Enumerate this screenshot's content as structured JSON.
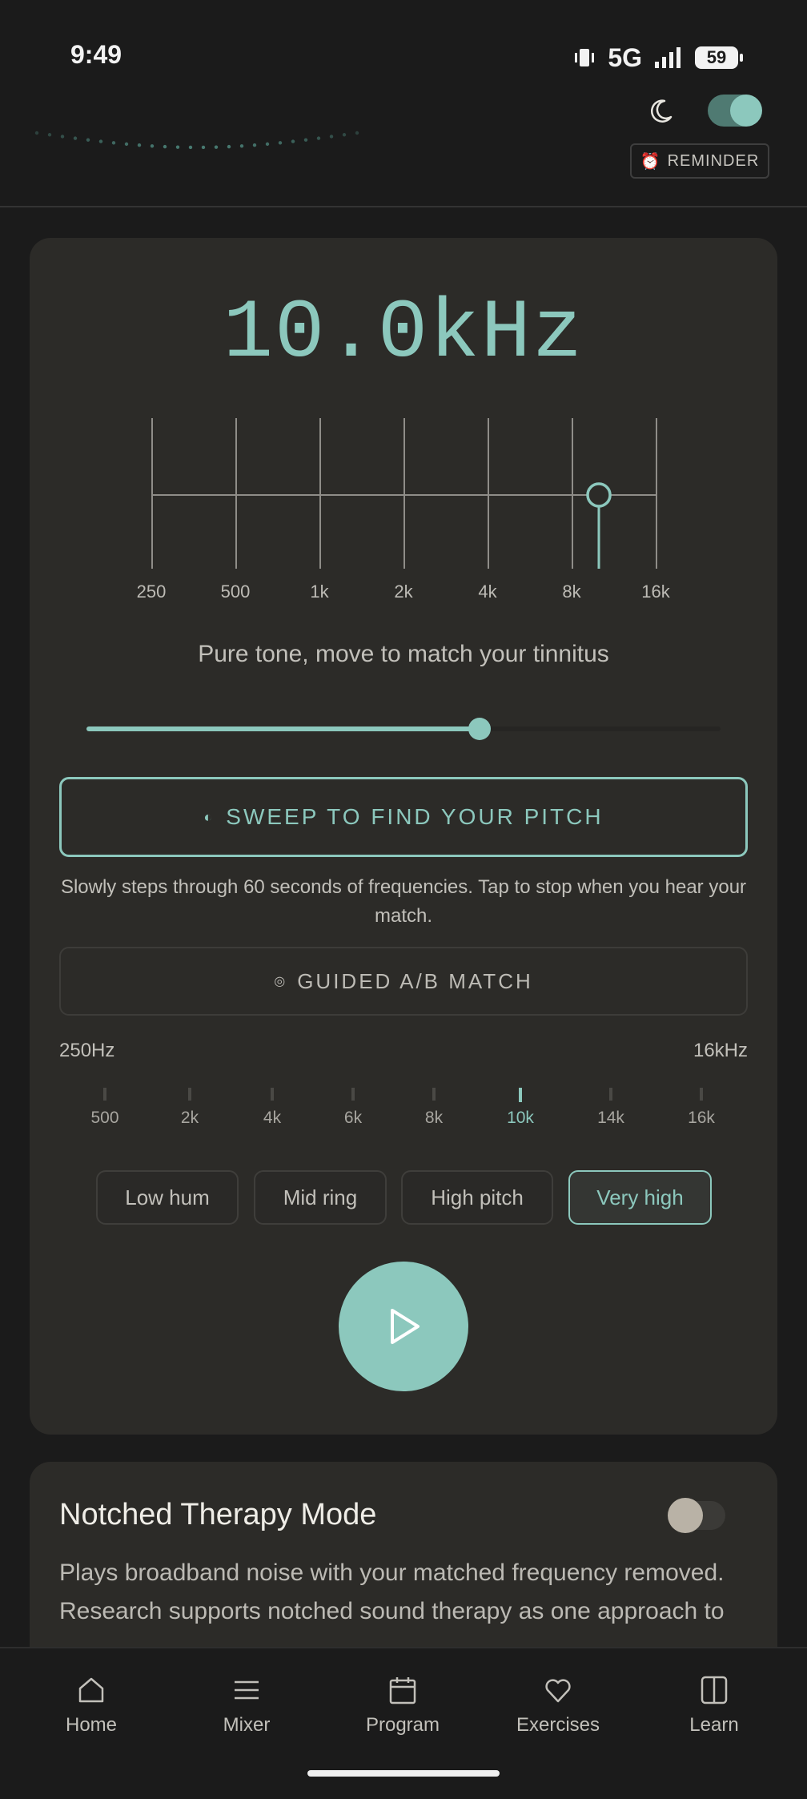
{
  "status_bar": {
    "time": "9:49",
    "network": "5G",
    "battery": "59"
  },
  "header": {
    "reminder_icon": "⏰",
    "reminder_label": "REMINDER",
    "dark_mode_icon": "moon-icon"
  },
  "matcher": {
    "frequency_display": "10.0kHz",
    "scale_labels": [
      "250",
      "500",
      "1k",
      "2k",
      "4k",
      "8k",
      "16k"
    ],
    "subtitle": "Pure tone, move to match your tinnitus",
    "slider_level": 0.62,
    "sweep_label": "SWEEP TO FIND YOUR PITCH",
    "sweep_icon": "◐",
    "sweep_description": "Slowly steps through 60 seconds of frequencies. Tap to stop when you hear your match.",
    "guided_label": "GUIDED A/B MATCH",
    "guided_icon": "◎",
    "range_min": "250Hz",
    "range_max": "16kHz",
    "ticks": [
      "500",
      "2k",
      "4k",
      "6k",
      "8k",
      "10k",
      "14k",
      "16k"
    ],
    "active_tick": "10k",
    "presets": [
      "Low hum",
      "Mid ring",
      "High pitch",
      "Very high"
    ],
    "selected_preset": "Very high"
  },
  "notched": {
    "title": "Notched Therapy Mode",
    "description": "Plays broadband noise with your matched frequency removed. Research supports notched sound therapy as one approach to"
  },
  "nav": {
    "items": [
      {
        "label": "Home",
        "icon": "home-icon"
      },
      {
        "label": "Mixer",
        "icon": "menu-icon"
      },
      {
        "label": "Program",
        "icon": "calendar-icon"
      },
      {
        "label": "Exercises",
        "icon": "heart-icon"
      },
      {
        "label": "Learn",
        "icon": "book-icon"
      }
    ]
  },
  "colors": {
    "accent": "#8cc8bd",
    "background": "#1b1b1b",
    "card": "#2c2b28"
  }
}
